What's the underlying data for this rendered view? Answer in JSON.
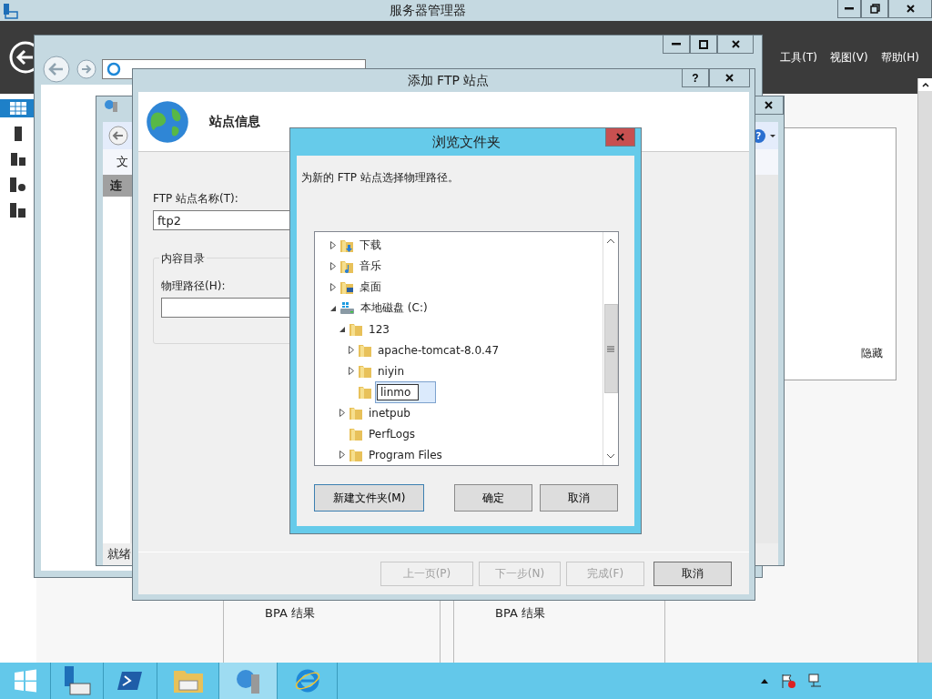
{
  "server_manager": {
    "title": "服务器管理器",
    "menu": [
      "工具(T)",
      "视图(V)",
      "帮助(H)"
    ],
    "hidden_label": "隐藏",
    "tiles": [
      {
        "label": "BPA 结果"
      },
      {
        "label": "BPA 结果"
      }
    ]
  },
  "iis_manager": {
    "help_label": "?",
    "menu_item": "文",
    "connections_header": "连",
    "status": "就绪"
  },
  "wizard": {
    "title": "添加 FTP 站点",
    "help_label": "?",
    "heading": "站点信息",
    "site_name_label": "FTP 站点名称(T):",
    "site_name_value": "ftp2",
    "group_label": "内容目录",
    "path_label": "物理路径(H):",
    "buttons": [
      {
        "label": "上一页(P)",
        "disabled": true
      },
      {
        "label": "下一步(N)",
        "disabled": true
      },
      {
        "label": "完成(F)",
        "disabled": true
      },
      {
        "label": "取消",
        "disabled": false
      }
    ]
  },
  "browse_dialog": {
    "title": "浏览文件夹",
    "prompt": "为新的 FTP 站点选择物理路径。",
    "tree": [
      {
        "label": "下载",
        "kind": "downloads",
        "expanded": false,
        "selected": false
      },
      {
        "label": "音乐",
        "kind": "music",
        "expanded": false,
        "selected": false
      },
      {
        "label": "桌面",
        "kind": "desktop",
        "expanded": false,
        "selected": false
      },
      {
        "label": "本地磁盘 (C:)",
        "kind": "drive",
        "expanded": true,
        "selected": false,
        "children": [
          {
            "label": "123",
            "kind": "folder",
            "expanded": true,
            "selected": false,
            "children": [
              {
                "label": "apache-tomcat-8.0.47",
                "kind": "folder",
                "expanded": false,
                "selected": false
              },
              {
                "label": "niyin",
                "kind": "folder",
                "expanded": false,
                "selected": false
              },
              {
                "label": "linmo",
                "kind": "rename",
                "selected": true
              }
            ]
          },
          {
            "label": "inetpub",
            "kind": "folder",
            "expanded": false,
            "selected": false
          },
          {
            "label": "PerfLogs",
            "kind": "folder",
            "selected": false
          },
          {
            "label": "Program Files",
            "kind": "folder",
            "expanded": false,
            "selected": false
          }
        ]
      }
    ],
    "buttons": [
      {
        "label": "新建文件夹(M)",
        "default": true
      },
      {
        "label": "确定",
        "default": false
      },
      {
        "label": "取消",
        "default": false
      }
    ]
  }
}
